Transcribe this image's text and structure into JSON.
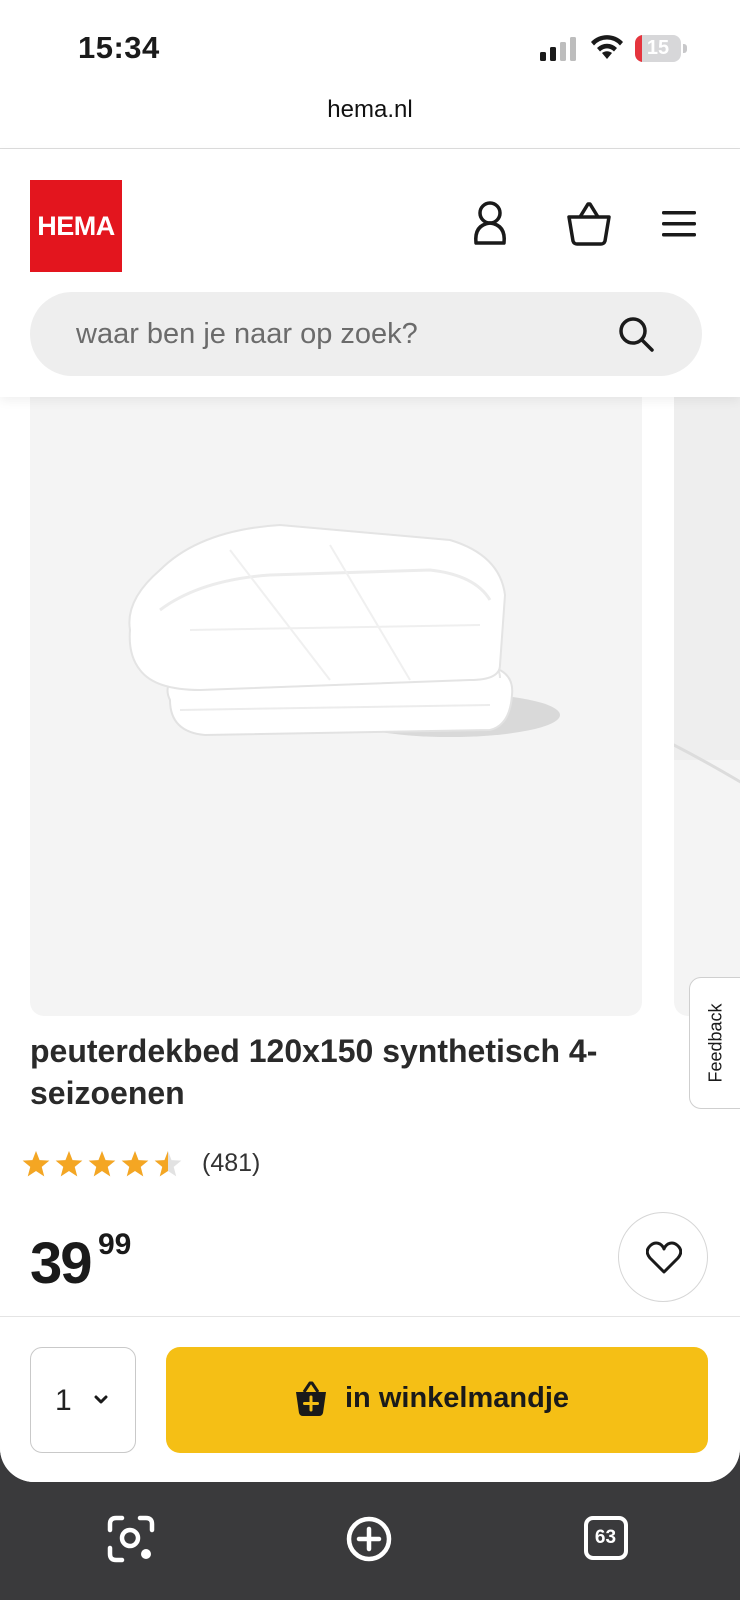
{
  "status_bar": {
    "time": "15:34",
    "battery_level": "15",
    "battery_fraction": 0.15
  },
  "browser": {
    "url": "hema.nl",
    "tab_count": "63"
  },
  "header": {
    "logo_text": "HEMA",
    "brand_color": "#e3151e",
    "search_placeholder": "waar ben je naar op zoek?"
  },
  "feedback_label": "Feedback",
  "product": {
    "title": "peuterdekbed 120x150 synthetisch 4-seizoenen",
    "rating": 4.5,
    "rating_max": 5,
    "review_count": "(481)",
    "price_whole": "39",
    "price_decimals": "99"
  },
  "buybar": {
    "quantity": "1",
    "add_to_cart_label": "in winkelmandje",
    "accent_color": "#f5bf15"
  },
  "icons": [
    "account-icon",
    "basket-icon",
    "menu-icon",
    "search-icon",
    "heart-icon",
    "chevron-down-icon",
    "visual-search-icon",
    "new-tab-icon",
    "tabs-icon"
  ]
}
